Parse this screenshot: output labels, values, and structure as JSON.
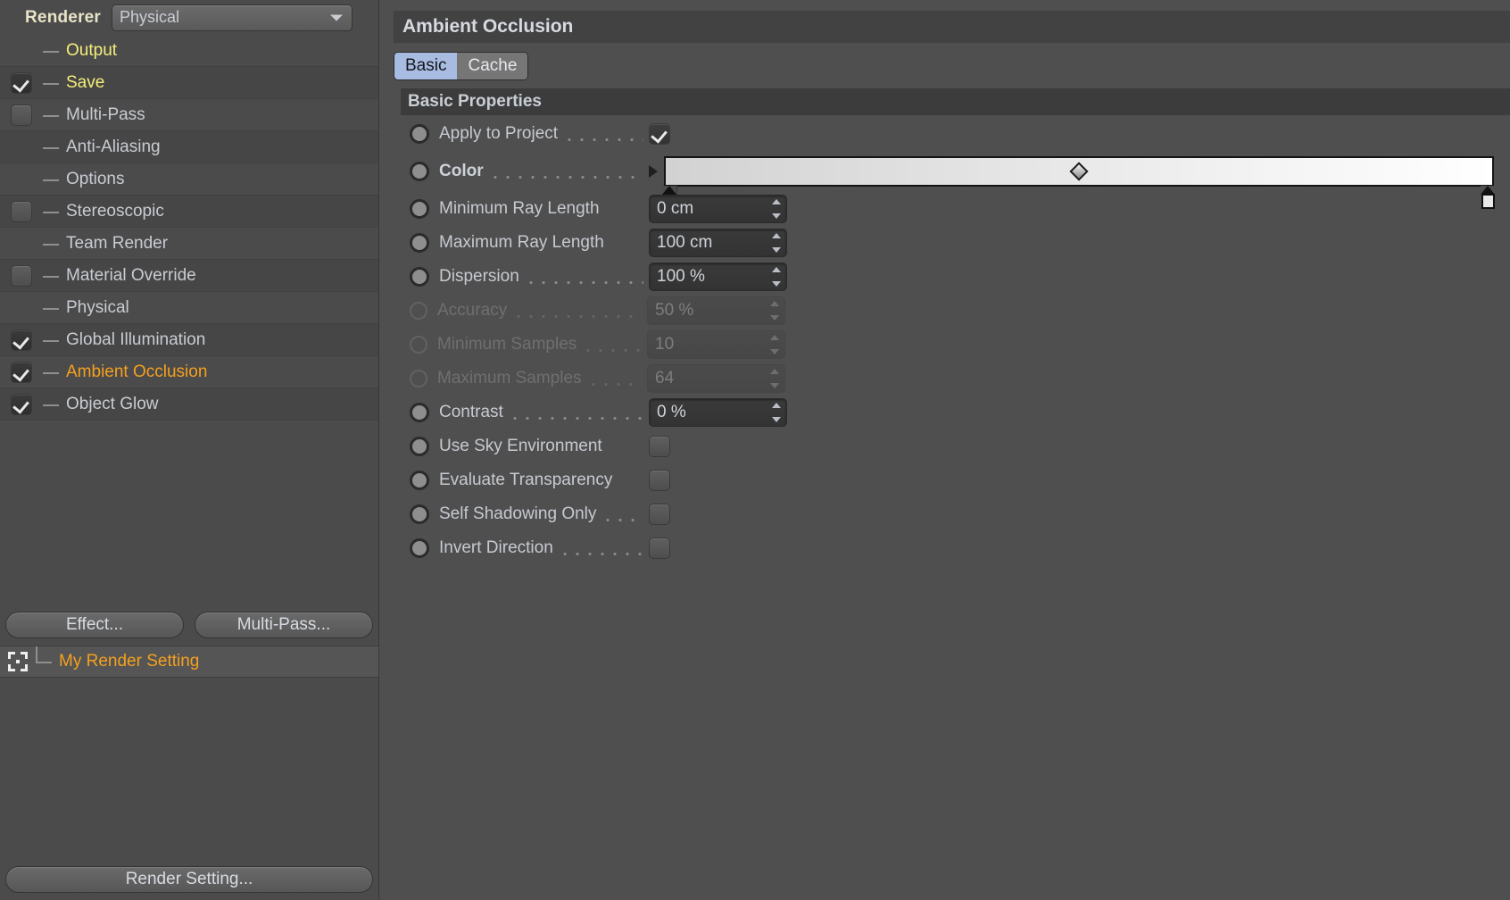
{
  "left_panel": {
    "renderer": {
      "label": "Renderer",
      "value": "Physical",
      "caret_icon": "chevron-down-icon"
    },
    "tree_items": [
      {
        "label": "Output",
        "checkbox": "none",
        "color": "yellow"
      },
      {
        "label": "Save",
        "checkbox": "checked",
        "color": "yellow"
      },
      {
        "label": "Multi-Pass",
        "checkbox": "unchecked",
        "color": "normal"
      },
      {
        "label": "Anti-Aliasing",
        "checkbox": "none",
        "color": "normal"
      },
      {
        "label": "Options",
        "checkbox": "none",
        "color": "normal"
      },
      {
        "label": "Stereoscopic",
        "checkbox": "unchecked",
        "color": "normal"
      },
      {
        "label": "Team Render",
        "checkbox": "none",
        "color": "normal"
      },
      {
        "label": "Material Override",
        "checkbox": "unchecked",
        "color": "normal"
      },
      {
        "label": "Physical",
        "checkbox": "none",
        "color": "normal"
      },
      {
        "label": "Global Illumination",
        "checkbox": "checked",
        "color": "normal"
      },
      {
        "label": "Ambient Occlusion",
        "checkbox": "checked",
        "color": "orange"
      },
      {
        "label": "Object Glow",
        "checkbox": "checked",
        "color": "normal"
      }
    ],
    "effect_button": "Effect...",
    "multipass_button": "Multi-Pass...",
    "render_setting_row": {
      "icon": "render-setting-bracket-icon",
      "label": "My Render Setting"
    },
    "render_setting_button": "Render Setting..."
  },
  "right_panel": {
    "title": "Ambient Occlusion",
    "tabs": [
      {
        "label": "Basic",
        "active": true
      },
      {
        "label": "Cache",
        "active": false
      }
    ],
    "section_title": "Basic Properties",
    "rows": [
      {
        "label": "Apply to Project",
        "type": "checkbox",
        "value": "checked",
        "leader": true,
        "enabled": true,
        "bold": false
      },
      {
        "label": "Color",
        "type": "gradient",
        "value": "",
        "leader": true,
        "enabled": true,
        "bold": true
      },
      {
        "label": "Minimum Ray Length",
        "type": "number",
        "value": "0 cm",
        "leader": false,
        "enabled": true,
        "bold": false
      },
      {
        "label": "Maximum Ray Length",
        "type": "number",
        "value": "100 cm",
        "leader": false,
        "enabled": true,
        "bold": false
      },
      {
        "label": "Dispersion",
        "type": "number",
        "value": "100 %",
        "leader": true,
        "enabled": true,
        "bold": false
      },
      {
        "label": "Accuracy",
        "type": "number",
        "value": "50 %",
        "leader": true,
        "enabled": false,
        "bold": false
      },
      {
        "label": "Minimum Samples",
        "type": "number",
        "value": "10",
        "leader": true,
        "enabled": false,
        "bold": false
      },
      {
        "label": "Maximum Samples",
        "type": "number",
        "value": "64",
        "leader": true,
        "enabled": false,
        "bold": false
      },
      {
        "label": "Contrast",
        "type": "number",
        "value": "0 %",
        "leader": true,
        "enabled": true,
        "bold": false
      },
      {
        "label": "Use Sky Environment",
        "type": "checkbox",
        "value": "unchecked",
        "leader": false,
        "enabled": true,
        "bold": false
      },
      {
        "label": "Evaluate Transparency",
        "type": "checkbox",
        "value": "unchecked",
        "leader": false,
        "enabled": true,
        "bold": false
      },
      {
        "label": "Self Shadowing Only",
        "type": "checkbox",
        "value": "unchecked",
        "leader": true,
        "enabled": true,
        "bold": false
      },
      {
        "label": "Invert Direction",
        "type": "checkbox",
        "value": "unchecked",
        "leader": true,
        "enabled": true,
        "bold": false
      }
    ],
    "gradient": {
      "expand_icon": "triangle-right-icon",
      "left_stop_color": "#d2d2d2",
      "right_stop_color": "#ffffff",
      "midpoint_icon": "diamond-handle-icon"
    }
  },
  "colors": {
    "accent_orange": "#f5a01e",
    "accent_yellow": "#f5ef7a",
    "tab_active": "#a8bbe0",
    "panel_bg": "#4f4f4f"
  }
}
